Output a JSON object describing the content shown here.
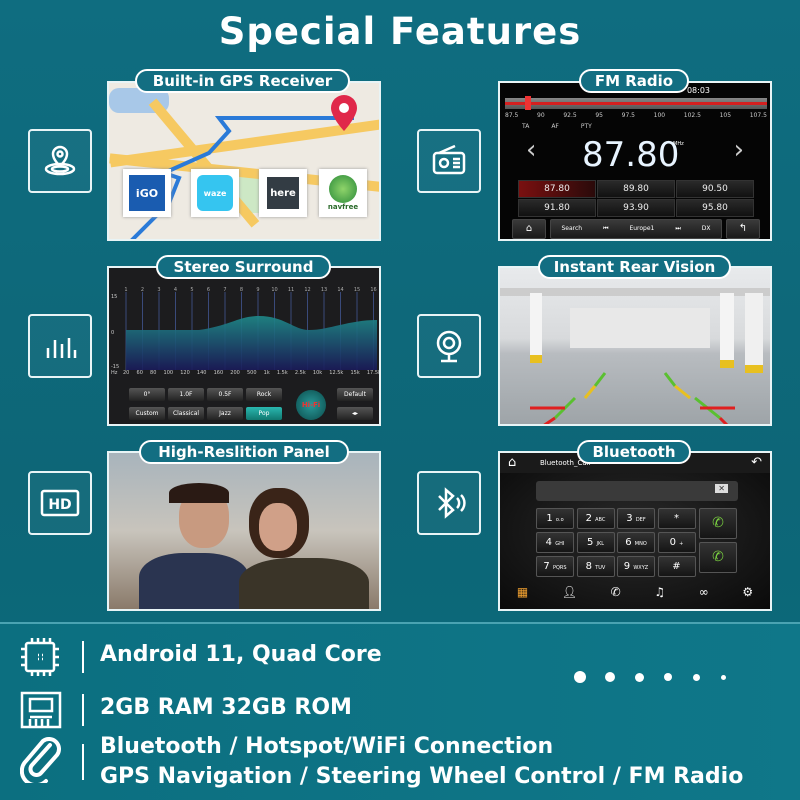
{
  "title": "Special Features",
  "colors": {
    "background": "#0f6d80",
    "pill": "#136e82",
    "fm_red": "#d42020",
    "eq_fill": "#1e8a8a",
    "call_green": "#5ab030"
  },
  "features": [
    {
      "label": "Built-in GPS Receiver",
      "icon": "location-pin-icon",
      "apps": [
        "iGO",
        "waze",
        "here",
        "navfree"
      ]
    },
    {
      "label": "FM Radio",
      "icon": "radio-icon"
    },
    {
      "label": "Stereo Surround",
      "icon": "equalizer-icon"
    },
    {
      "label": "Instant Rear Vision",
      "icon": "camera-icon"
    },
    {
      "label": "High-Reslition Panel",
      "icon": "hd-icon"
    },
    {
      "label": "Bluetooth",
      "icon": "bluetooth-icon"
    }
  ],
  "fm": {
    "time": "08:03",
    "scale": [
      "87.5",
      "90",
      "92.5",
      "95",
      "97.5",
      "100",
      "102.5",
      "105",
      "107.5"
    ],
    "toggles": [
      "TA",
      "AF",
      "PTY"
    ],
    "frequency": "87.80",
    "unit": "MHz",
    "presets": [
      "87.80",
      "89.80",
      "90.50",
      "91.80",
      "93.90",
      "95.80"
    ],
    "controls": {
      "search": "Search",
      "station": "Europe1",
      "dx": "DX"
    },
    "tuner_position": 0.02
  },
  "eq": {
    "bands": [
      "1",
      "2",
      "3",
      "4",
      "5",
      "6",
      "7",
      "8",
      "9",
      "10",
      "11",
      "12",
      "13",
      "14",
      "15",
      "16"
    ],
    "freqs": [
      "20",
      "60",
      "80",
      "100",
      "120",
      "140",
      "160",
      "200",
      "500",
      "1k",
      "1.5k",
      "2.5k",
      "10k",
      "12.5k",
      "15k",
      "17.5k"
    ],
    "yticks": [
      "15",
      "0",
      "-15"
    ],
    "unit": "Hz",
    "presets": [
      "0°",
      "1.0F",
      "0.5F",
      "Rock",
      "Custom",
      "Classical",
      "Jazz",
      "Pop"
    ],
    "active": "Pop",
    "hifi": "Hi-Fi",
    "default": "Default"
  },
  "bluetooth": {
    "title": "Bluetooth_Call",
    "keys": [
      [
        "1",
        "ᴏ.ᴏ"
      ],
      [
        "2",
        "ABC"
      ],
      [
        "3",
        "DEF"
      ],
      [
        "*",
        ""
      ],
      [
        "4",
        "GHI"
      ],
      [
        "5",
        "JKL"
      ],
      [
        "6",
        "MNO"
      ],
      [
        "0",
        "+"
      ],
      [
        "7",
        "PQRS"
      ],
      [
        "8",
        "TUV"
      ],
      [
        "9",
        "WXYZ"
      ],
      [
        "#",
        ""
      ]
    ]
  },
  "specs": [
    {
      "icon": "cpu-icon",
      "text": "Android 11, Quad Core"
    },
    {
      "icon": "memory-card-icon",
      "text": "2GB RAM 32GB ROM"
    },
    {
      "icon": "link-icon",
      "lines": [
        "Bluetooth / Hotspot/WiFi Connection",
        "GPS Navigation / Steering Wheel Control / FM Radio"
      ]
    }
  ]
}
